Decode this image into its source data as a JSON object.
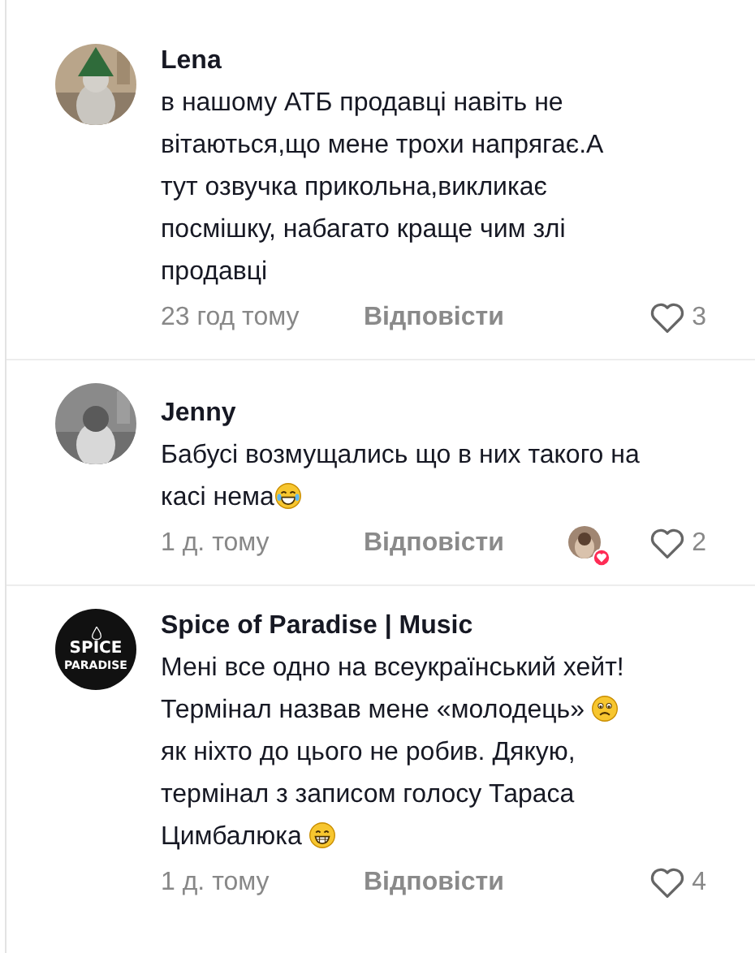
{
  "comments": [
    {
      "author": "Lena",
      "avatar": {
        "kind": "picture"
      },
      "body": [
        {
          "kind": "text",
          "text": "в нашому АТБ продавці навіть не вітаються,що мене трохи напрягає.А тут озвучка прикольна,викликає посмішку, набагато краще чим злі продавці"
        }
      ],
      "time": "23 год тому",
      "reply": "Відповісти",
      "creator_liked": false,
      "liked": false,
      "likes": "3"
    },
    {
      "author": "Jenny",
      "avatar": {
        "kind": "picture"
      },
      "body": [
        {
          "kind": "text",
          "text": "Бабусі возмущались що в них такого на касі нема"
        },
        {
          "kind": "laughing-emoji"
        }
      ],
      "time": "1 д. тому",
      "reply": "Відповісти",
      "creator_liked": true,
      "liked": false,
      "likes": "2"
    },
    {
      "author": "Spice of Paradise | Music",
      "avatar": {
        "kind": "logo",
        "lines": [
          "SPICE",
          "PARADISE"
        ]
      },
      "body": [
        {
          "kind": "text",
          "text": "Мені все одно на всеукраїнський хейт! Термінал назвав мене «молодець» "
        },
        {
          "kind": "sad-emoji"
        },
        {
          "kind": "text",
          "text": " як ніхто до цього не робив. Дякую, термінал з записом голосу Тараса Цимбалюка "
        },
        {
          "kind": "grin-emoji"
        }
      ],
      "time": "1 д. тому",
      "reply": "Відповісти",
      "creator_liked": false,
      "liked": false,
      "likes": "4"
    }
  ]
}
